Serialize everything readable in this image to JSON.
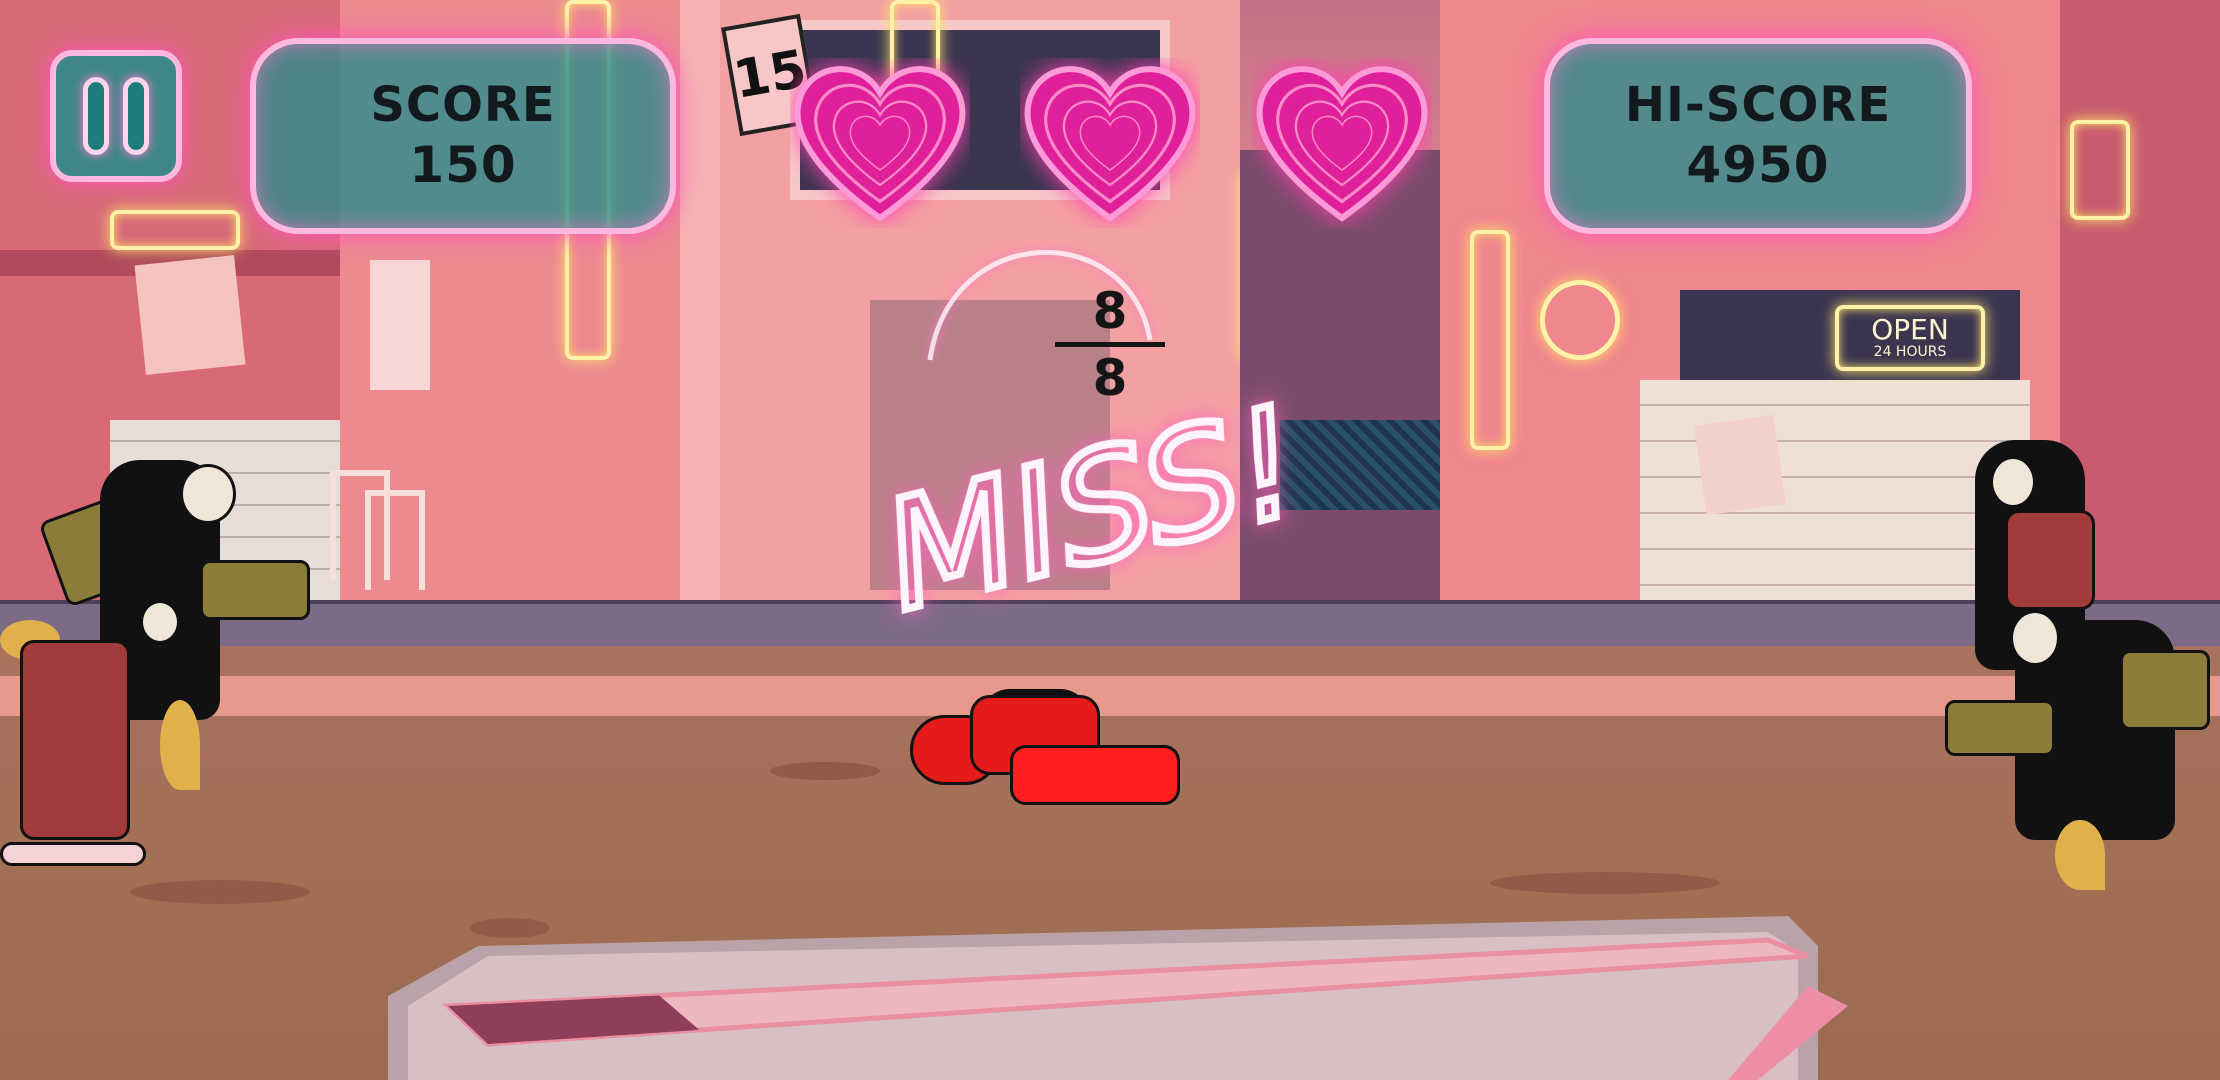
{
  "hud": {
    "score_label": "SCORE",
    "score_value": "150",
    "hiscore_label": "HI-SCORE",
    "hiscore_value": "4950",
    "pause_icon": "pause-icon",
    "lives": 3,
    "life_icon": "heart-icon"
  },
  "beat": {
    "numerator": "8",
    "denominator": "8"
  },
  "feedback": {
    "text": "MISS!"
  },
  "scenery": {
    "sign_open": "OPEN",
    "sign_hours": "24 HOURS",
    "sign_number": "15"
  },
  "timing_bar": {
    "fill_fraction": 0.16
  },
  "colors": {
    "neon_pink": "#ff56b8",
    "panel_teal": "#268c8c",
    "heart_magenta": "#e0209a",
    "player_red": "#e51a1a"
  }
}
